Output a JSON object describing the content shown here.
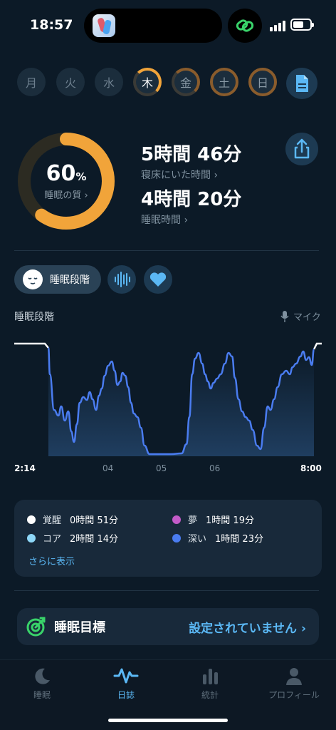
{
  "status_bar": {
    "time": "18:57"
  },
  "days": [
    {
      "label": "月",
      "state": "empty"
    },
    {
      "label": "火",
      "state": "empty"
    },
    {
      "label": "水",
      "state": "empty"
    },
    {
      "label": "木",
      "state": "active"
    },
    {
      "label": "金",
      "state": "ring"
    },
    {
      "label": "土",
      "state": "ring"
    },
    {
      "label": "日",
      "state": "ring"
    }
  ],
  "score": {
    "value": "60",
    "unit": "%",
    "label": "睡眠の質",
    "fraction": 0.6
  },
  "metrics": {
    "in_bed": {
      "value": "5時間 46分",
      "label": "寝床にいた時間"
    },
    "asleep": {
      "value": "4時間 20分",
      "label": "睡眠時間"
    }
  },
  "tabs": {
    "stages_label": "睡眠段階"
  },
  "chart_section": {
    "title": "睡眠段階",
    "mic_label": "マイク"
  },
  "time_axis": [
    "2:14",
    "04",
    "05",
    "06",
    "8:00"
  ],
  "legend": {
    "items": [
      {
        "name": "覚醒",
        "value": "0時間 51分",
        "color": "#ffffff"
      },
      {
        "name": "夢",
        "value": "1時間 19分",
        "color": "#c35bc8"
      },
      {
        "name": "コア",
        "value": "2時間 14分",
        "color": "#8ed7f7"
      },
      {
        "name": "深い",
        "value": "1時間 23分",
        "color": "#4a7cf0"
      }
    ],
    "more": "さらに表示"
  },
  "goal": {
    "title": "睡眠目標",
    "status": "設定されていません"
  },
  "nav": [
    {
      "label": "睡眠",
      "active": false
    },
    {
      "label": "日誌",
      "active": true
    },
    {
      "label": "統計",
      "active": false
    },
    {
      "label": "プロフィール",
      "active": false
    }
  ],
  "colors": {
    "accent": "#f1a43a",
    "link": "#5bb8f5",
    "dream": "#c35bc8",
    "core": "#8ed7f7",
    "deep": "#4a7cf0"
  }
}
